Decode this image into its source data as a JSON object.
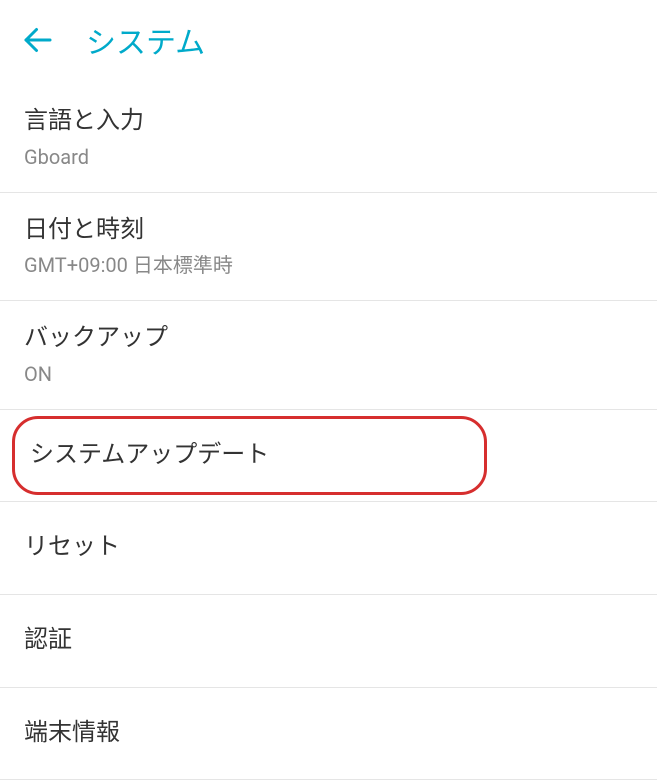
{
  "header": {
    "title": "システム"
  },
  "items": [
    {
      "title": "言語と入力",
      "subtitle": "Gboard"
    },
    {
      "title": "日付と時刻",
      "subtitle": "GMT+09:00 日本標準時"
    },
    {
      "title": "バックアップ",
      "subtitle": "ON"
    },
    {
      "title": "システムアップデート",
      "subtitle": null,
      "highlighted": true
    },
    {
      "title": "リセット",
      "subtitle": null
    },
    {
      "title": "認証",
      "subtitle": null
    },
    {
      "title": "端末情報",
      "subtitle": null
    }
  ]
}
